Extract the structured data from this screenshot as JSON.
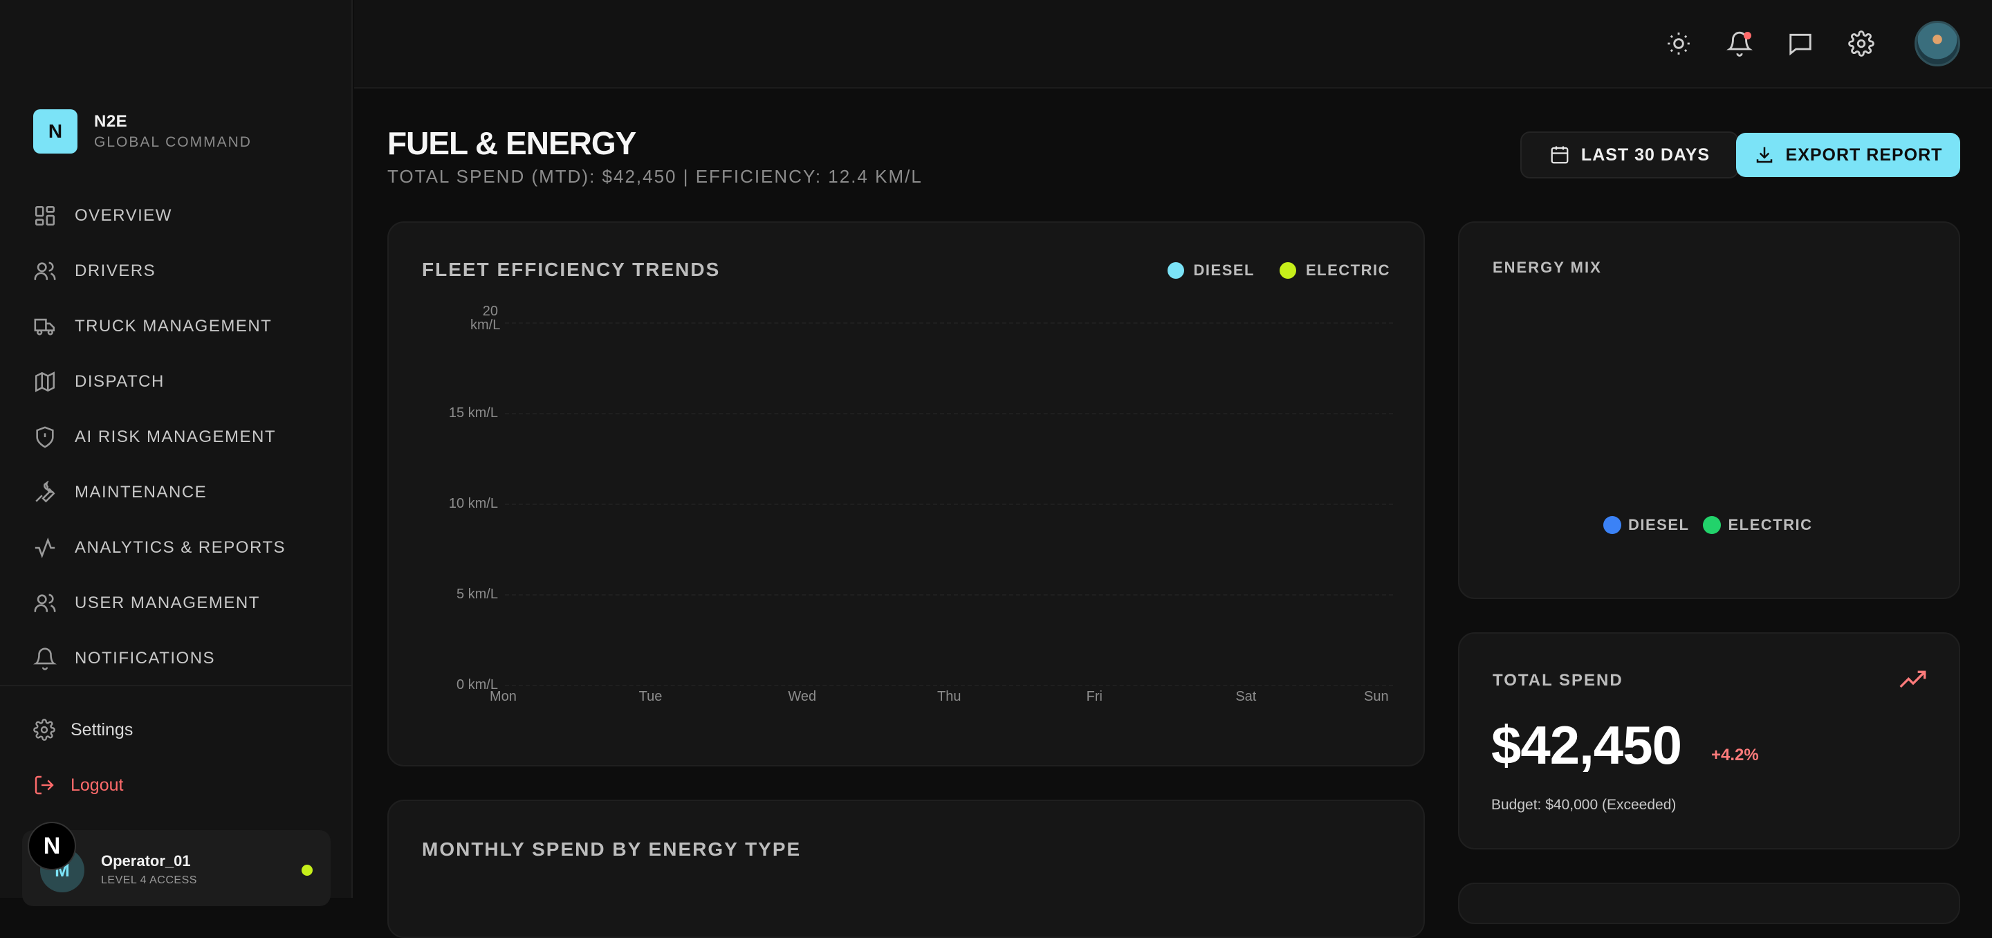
{
  "brand": {
    "logo_letter": "N",
    "name": "N2E",
    "subtitle": "GLOBAL COMMAND"
  },
  "nav": [
    {
      "label": "OVERVIEW",
      "icon": "grid-icon"
    },
    {
      "label": "DRIVERS",
      "icon": "users-icon"
    },
    {
      "label": "TRUCK MANAGEMENT",
      "icon": "truck-icon"
    },
    {
      "label": "DISPATCH",
      "icon": "map-icon"
    },
    {
      "label": "AI RISK MANAGEMENT",
      "icon": "shield-alert-icon"
    },
    {
      "label": "MAINTENANCE",
      "icon": "wrench-icon"
    },
    {
      "label": "ANALYTICS & REPORTS",
      "icon": "activity-icon"
    },
    {
      "label": "USER MANAGEMENT",
      "icon": "users-icon"
    },
    {
      "label": "NOTIFICATIONS",
      "icon": "bell-icon"
    }
  ],
  "bottom_nav": {
    "settings": "Settings",
    "logout": "Logout"
  },
  "user": {
    "initial": "M",
    "name": "Operator_01",
    "level": "LEVEL 4 ACCESS",
    "status_color": "#c6ef1a"
  },
  "next_badge": "N",
  "topbar_icons": [
    "sun-icon",
    "bell-icon",
    "message-icon",
    "gear-icon",
    "user-avatar"
  ],
  "page": {
    "title": "FUEL & ENERGY",
    "subtitle": "TOTAL SPEND (MTD): $42,450 | EFFICIENCY: 12.4 KM/L",
    "range_button": "LAST 30 DAYS",
    "export_button": "EXPORT REPORT"
  },
  "efficiency_card": {
    "title": "FLEET EFFICIENCY TRENDS",
    "legend": [
      {
        "label": "DIESEL",
        "color": "#7be3f7"
      },
      {
        "label": "ELECTRIC",
        "color": "#c6ef1a"
      }
    ]
  },
  "chart_data": {
    "type": "line",
    "title": "FLEET EFFICIENCY TRENDS",
    "x": [
      "Mon",
      "Tue",
      "Wed",
      "Thu",
      "Fri",
      "Sat",
      "Sun"
    ],
    "y_ticks": [
      "20 km/L",
      "15 km/L",
      "10 km/L",
      "5 km/L",
      "0 km/L"
    ],
    "ylim": [
      0,
      20
    ],
    "series": [
      {
        "name": "DIESEL",
        "values": []
      },
      {
        "name": "ELECTRIC",
        "values": []
      }
    ],
    "grid": true,
    "legend_position": "top-right"
  },
  "energy_mix_card": {
    "title": "ENERGY MIX",
    "legend": [
      {
        "label": "DIESEL",
        "color": "#3b82f6"
      },
      {
        "label": "ELECTRIC",
        "color": "#22d36b"
      }
    ]
  },
  "total_spend_card": {
    "title": "TOTAL SPEND",
    "value": "$42,450",
    "change": "+4.2%",
    "budget": "Budget: $40,000 (Exceeded)",
    "trend_color": "#ff7b7b"
  },
  "monthly_card": {
    "title": "MONTHLY SPEND BY ENERGY TYPE"
  }
}
